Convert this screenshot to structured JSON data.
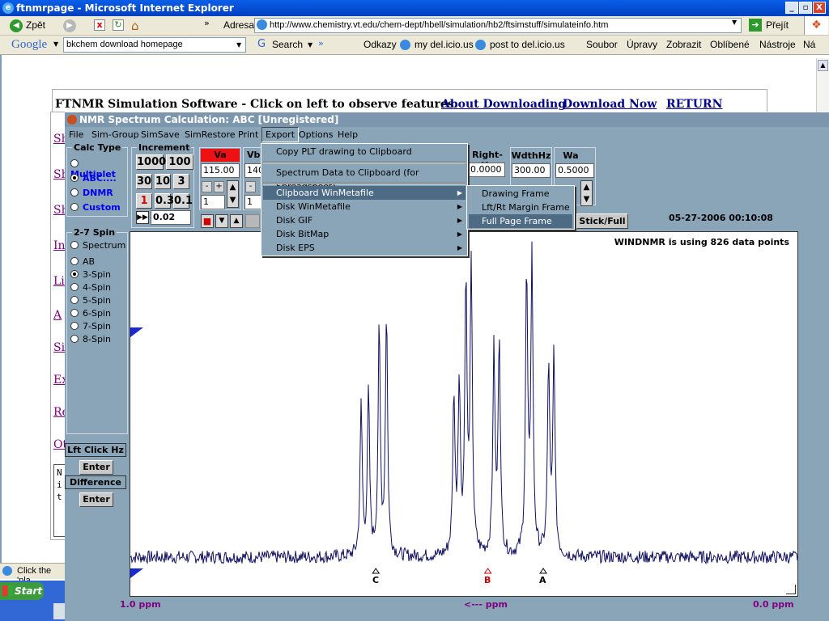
{
  "browser": {
    "title": "ftnmrpage - Microsoft Internet Explorer",
    "window_buttons": [
      "_",
      "▫",
      "X"
    ],
    "back_label": "Zpět",
    "address_label": "Adresa",
    "address_value": "http://www.chemistry.vt.edu/chem-dept/hbell/simulation/hb2/ftsimstuff/simulateinfo.htm",
    "go_label": "Přejít",
    "google_label": "Google",
    "google_search_value": "bkchem download homepage",
    "search_label": "Search",
    "links": [
      "Odkazy",
      "my del.icio.us",
      "post to del.icio.us"
    ],
    "menu": [
      "Soubor",
      "Úpravy",
      "Zobrazit",
      "Oblíbené",
      "Nástroje",
      "Ná"
    ],
    "status_text": "Click the 'pla",
    "start_label": "Start"
  },
  "page": {
    "heading": "FTNMR Simulation Software - Click on left to observe features.",
    "links": [
      "About Downloading",
      "Download Now",
      "RETURN"
    ],
    "side_links": [
      "Sh",
      "Sh",
      "Sh",
      "In",
      "Li",
      "A",
      "Si",
      "Ex",
      "Re",
      "Ot"
    ],
    "textbox_lines": [
      "N",
      "i",
      "t"
    ]
  },
  "app": {
    "title": "NMR Spectrum Calculation:  ABC [Unregistered]",
    "menu": [
      "File",
      "Sim-Group",
      "SimSave",
      "SimRestore",
      "Print",
      "Export",
      "Options",
      "Help"
    ],
    "calc_type": {
      "label": "Calc Type",
      "options": [
        "Multiplet",
        "ABC....",
        "DNMR",
        "Custom"
      ],
      "selected": 1
    },
    "increment": {
      "label": "Increment",
      "buttons": [
        "1000",
        "100",
        "30",
        "10",
        "3",
        "1",
        "0.3",
        "0.1"
      ],
      "value": "0.02"
    },
    "params": [
      {
        "label": "Va",
        "value": "115.00",
        "step": "1"
      },
      {
        "label": "Vb",
        "value": "140",
        "step": "1"
      }
    ],
    "right_params": [
      {
        "label": "Right-Hz",
        "value": "0.0000"
      },
      {
        "label": "WdthHz",
        "value": "300.00"
      },
      {
        "label": "Wa",
        "value": "0.5000"
      }
    ],
    "spin": {
      "label": "2-7 Spin",
      "options": [
        "Spectrum",
        "AB",
        "3-Spin",
        "4-Spin",
        "5-Spin",
        "6-Spin",
        "7-Spin",
        "8-Spin"
      ],
      "selected": 2
    },
    "buttons": {
      "lft_click": "Lft Click Hz",
      "enter1": "Enter",
      "difference": "Difference",
      "enter2": "Enter",
      "stick_full": "Stick/Full"
    },
    "timestamp": "05-27-2006   00:10:08",
    "data_points_text": "WINDNMR is using 826 data points",
    "export_menu": [
      "Copy PLT drawing to Clipboard",
      "Spectrum Data to Clipboard (for Spreadsheet)",
      "Clipboard WinMetafile",
      "Disk WinMetafile",
      "Disk GIF",
      "Disk BitMap",
      "Disk EPS"
    ],
    "submenu": [
      "Drawing Frame",
      "Lft/Rt Margin Frame",
      "Full Page Frame"
    ],
    "peak_labels": [
      "C",
      "B",
      "A"
    ],
    "axis": {
      "left": "1.0 ppm",
      "center": "<--- ppm",
      "right": "0.0 ppm"
    }
  },
  "chart_data": {
    "type": "line",
    "xlabel": "<--- ppm",
    "xlim": [
      1.0,
      0.0
    ],
    "peaks": [
      {
        "x": 0.654,
        "y": 0.37
      },
      {
        "x": 0.643,
        "y": 0.4
      },
      {
        "x": 0.627,
        "y": 0.56
      },
      {
        "x": 0.616,
        "y": 0.6
      },
      {
        "x": 0.515,
        "y": 0.39
      },
      {
        "x": 0.507,
        "y": 0.42
      },
      {
        "x": 0.497,
        "y": 0.67
      },
      {
        "x": 0.489,
        "y": 0.7
      },
      {
        "x": 0.455,
        "y": 0.5
      },
      {
        "x": 0.447,
        "y": 0.54
      },
      {
        "x": 0.406,
        "y": 0.69
      },
      {
        "x": 0.398,
        "y": 0.73
      },
      {
        "x": 0.373,
        "y": 0.47
      },
      {
        "x": 0.365,
        "y": 0.5
      }
    ],
    "markers": [
      {
        "label": "C",
        "x": 0.632
      },
      {
        "label": "B",
        "x": 0.464
      },
      {
        "label": "A",
        "x": 0.381
      }
    ]
  }
}
